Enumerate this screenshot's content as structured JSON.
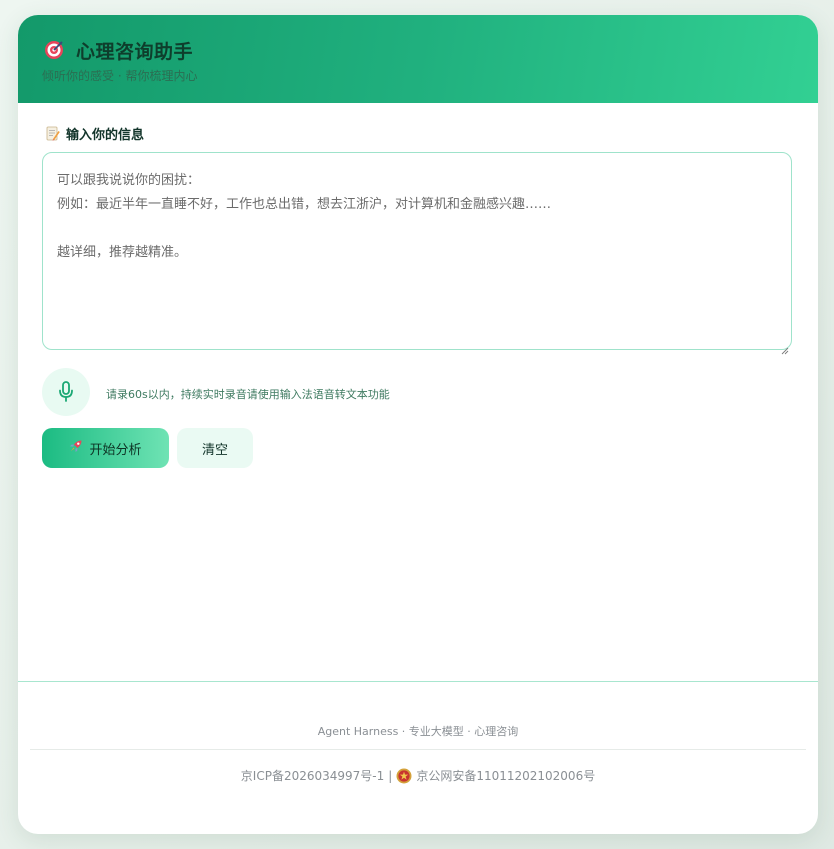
{
  "header": {
    "icon": "target-icon",
    "title": "心理咨询助手",
    "subtitle": "倾听你的感受 · 帮你梳理内心"
  },
  "input_section": {
    "icon": "memo-icon",
    "label": "输入你的信息",
    "placeholder": "可以跟我说说你的困扰：\n例如：最近半年一直睡不好，工作也总出错，想去江浙沪，对计算机和金融感兴趣……\n\n越详细，推荐越精准。",
    "value": ""
  },
  "voice": {
    "icon": "microphone-icon",
    "hint": "请录60s以内，持续实时录音请使用输入法语音转文本功能"
  },
  "actions": {
    "analyze_icon": "rocket-icon",
    "analyze_label": "开始分析",
    "clear_label": "清空"
  },
  "footer": {
    "credit": "Agent Harness · 专业大模型 · 心理咨询",
    "icp": "京ICP备2026034997号-1",
    "separator": "|",
    "police_icon": "police-badge-icon",
    "police_record": "京公网安备11011202102006号"
  },
  "colors": {
    "accent": "#1bbb82",
    "header_start": "#13996a",
    "header_end": "#32d093",
    "input_border": "#9fe3cb"
  }
}
